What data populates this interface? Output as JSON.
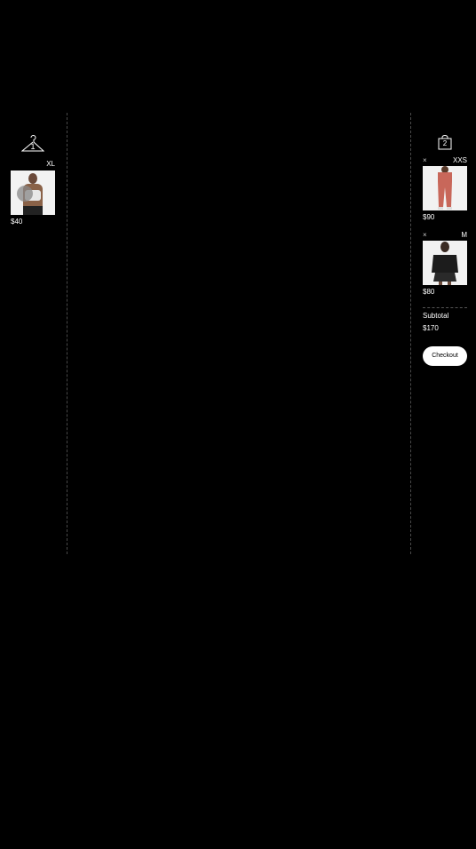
{
  "fitting_room": {
    "icon": "hanger-icon",
    "count": "1",
    "items": [
      {
        "size": "XL",
        "price": "$40"
      }
    ]
  },
  "bag": {
    "icon": "shopping-bag-icon",
    "count": "2",
    "items": [
      {
        "remove": "×",
        "size": "XXS",
        "price": "$90"
      },
      {
        "remove": "×",
        "size": "M",
        "price": "$80"
      }
    ],
    "subtotal_label": "Subtotal",
    "subtotal_value": "$170",
    "checkout_label": "Checkout"
  },
  "colors": {
    "background": "#000000",
    "text": "#ffffff",
    "button_bg": "#ffffff",
    "leggings": "#c8675a"
  }
}
